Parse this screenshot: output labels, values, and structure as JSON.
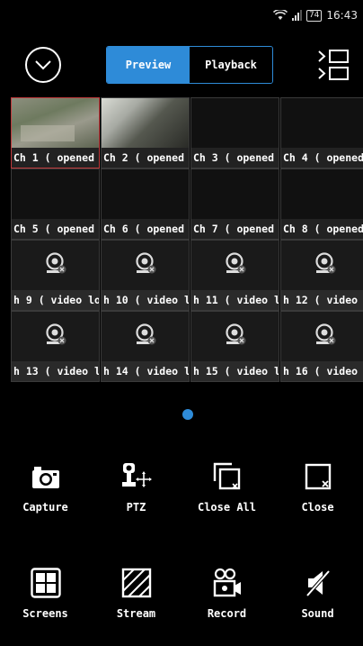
{
  "status_bar": {
    "battery": "74",
    "time": "16:43"
  },
  "header": {
    "menu_icon": "chevron-down-circle-icon",
    "tabs": [
      {
        "label": "Preview",
        "active": true
      },
      {
        "label": "Playback",
        "active": false
      }
    ],
    "device_list_icon": "device-list-icon"
  },
  "grid": {
    "channels": [
      {
        "label": "Ch 1 ( opened",
        "state": "live",
        "selected": true
      },
      {
        "label": "Ch 2 ( opened",
        "state": "live"
      },
      {
        "label": "Ch 3 ( opened",
        "state": "opened"
      },
      {
        "label": "Ch 4 ( opened",
        "state": "opened"
      },
      {
        "label": "Ch 5 ( opened",
        "state": "opened"
      },
      {
        "label": "Ch 6 ( opened",
        "state": "opened"
      },
      {
        "label": "Ch 7 ( opened",
        "state": "opened"
      },
      {
        "label": "Ch 8 ( opened",
        "state": "opened"
      },
      {
        "label": "h 9 ( video lo",
        "state": "no-video"
      },
      {
        "label": "h 10 ( video l",
        "state": "no-video"
      },
      {
        "label": "h 11 ( video l",
        "state": "no-video"
      },
      {
        "label": "h 12 ( video l",
        "state": "no-video"
      },
      {
        "label": "h 13 ( video l",
        "state": "no-video"
      },
      {
        "label": "h 14 ( video l",
        "state": "no-video"
      },
      {
        "label": "h 15 ( video l",
        "state": "no-video"
      },
      {
        "label": "h 16 ( video",
        "state": "no-video"
      }
    ]
  },
  "pager": {
    "pages": 1,
    "current": 1,
    "color": "#2e8bd8"
  },
  "toolbar": {
    "row1": [
      {
        "label": "Capture",
        "icon": "camera-icon"
      },
      {
        "label": "PTZ",
        "icon": "ptz-icon"
      },
      {
        "label": "Close All",
        "icon": "close-all-icon"
      },
      {
        "label": "Close",
        "icon": "close-window-icon"
      }
    ],
    "row2": [
      {
        "label": "Screens",
        "icon": "screens-grid-icon"
      },
      {
        "label": "Stream",
        "icon": "stream-icon"
      },
      {
        "label": "Record",
        "icon": "record-icon"
      },
      {
        "label": "Sound",
        "icon": "sound-muted-icon"
      }
    ]
  },
  "colors": {
    "accent": "#2e8bd8",
    "selected_border": "#c0393b"
  }
}
